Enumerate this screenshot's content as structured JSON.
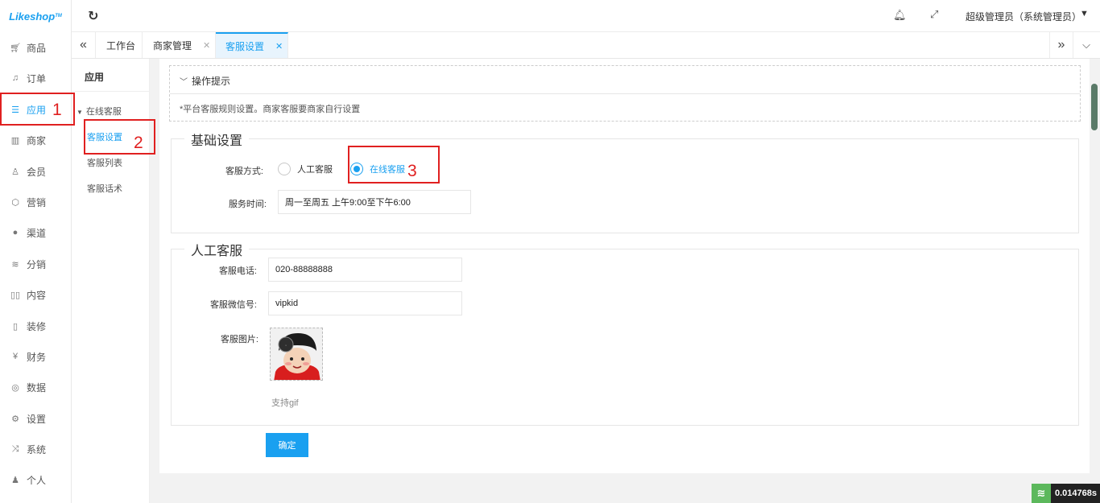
{
  "brand": {
    "logo_text": "Likeshop",
    "logo_tm": "TM"
  },
  "nav": {
    "items": [
      {
        "label": "商品",
        "icon": "cart-icon"
      },
      {
        "label": "订单",
        "icon": "bell-icon"
      },
      {
        "label": "应用",
        "icon": "list-icon"
      },
      {
        "label": "商家",
        "icon": "shop-icon"
      },
      {
        "label": "会员",
        "icon": "user-icon"
      },
      {
        "label": "营销",
        "icon": "cube-icon"
      },
      {
        "label": "渠道",
        "icon": "globe-icon"
      },
      {
        "label": "分销",
        "icon": "layers-icon"
      },
      {
        "label": "内容",
        "icon": "book-icon"
      },
      {
        "label": "装修",
        "icon": "tablet-icon"
      },
      {
        "label": "财务",
        "icon": "yen-icon"
      },
      {
        "label": "数据",
        "icon": "chart-icon"
      },
      {
        "label": "设置",
        "icon": "gear-icon"
      },
      {
        "label": "系统",
        "icon": "shuffle-icon"
      },
      {
        "label": "个人",
        "icon": "person-icon"
      }
    ],
    "active_index": 2
  },
  "topbar": {
    "user_label": "超级管理员（系统管理员）"
  },
  "tabs": [
    {
      "label": "工作台",
      "closable": false
    },
    {
      "label": "商家管理",
      "closable": true
    },
    {
      "label": "客服设置",
      "closable": true,
      "active": true
    }
  ],
  "submenu": {
    "title": "应用",
    "group": "在线客服",
    "items": [
      "客服设置",
      "客服列表",
      "客服话术"
    ],
    "active_index": 0
  },
  "tips": {
    "title": "操作提示",
    "text": "*平台客服规则设置。商家客服要商家自行设置"
  },
  "basic": {
    "legend": "基础设置",
    "mode_label": "客服方式:",
    "mode_options": [
      "人工客服",
      "在线客服"
    ],
    "mode_selected": 1,
    "time_label": "服务时间:",
    "time_value": "周一至周五 上午9:00至下午6:00"
  },
  "manual": {
    "legend": "人工客服",
    "phone_label": "客服电话:",
    "phone_value": "020-88888888",
    "wechat_label": "客服微信号:",
    "wechat_value": "vipkid",
    "image_label": "客服图片:",
    "image_hint": "支持gif"
  },
  "confirm_label": "确定",
  "annotations": [
    "1",
    "2",
    "3"
  ],
  "perf": {
    "time": "0.014768s"
  },
  "colors": {
    "accent": "#1aa0f0",
    "annotation": "#e02020"
  }
}
